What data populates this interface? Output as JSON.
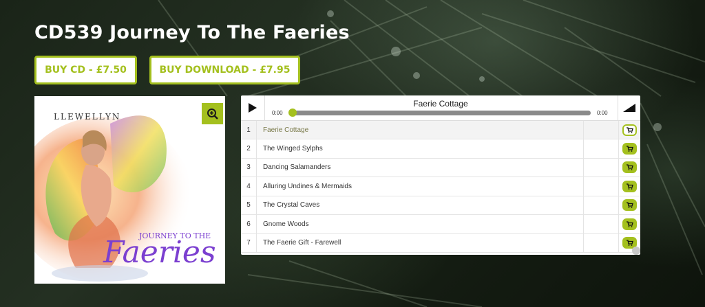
{
  "page": {
    "title": "CD539 Journey To The Faeries"
  },
  "buttons": {
    "buy_cd": "BUY CD - £7.50",
    "buy_download": "BUY DOWNLOAD - £7.95"
  },
  "cover": {
    "artist": "LLEWELLYN",
    "line1": "JOURNEY TO THE",
    "line2": "Faeries"
  },
  "player": {
    "now_playing": "Faerie Cottage",
    "current_time": "0:00",
    "duration": "0:00",
    "progress": 0
  },
  "tracks": [
    {
      "num": "1",
      "title": "Faerie Cottage"
    },
    {
      "num": "2",
      "title": "The Winged Sylphs"
    },
    {
      "num": "3",
      "title": "Dancing Salamanders"
    },
    {
      "num": "4",
      "title": "Alluring Undines & Mermaids"
    },
    {
      "num": "5",
      "title": "The Crystal Caves"
    },
    {
      "num": "6",
      "title": "Gnome Woods"
    },
    {
      "num": "7",
      "title": "The Faerie Gift - Farewell"
    }
  ],
  "colors": {
    "accent": "#a4c01e",
    "background": "#1a2418"
  },
  "icons": {
    "zoom": "zoom-in-icon",
    "play": "play-icon",
    "volume": "volume-icon",
    "cart": "cart-icon"
  }
}
